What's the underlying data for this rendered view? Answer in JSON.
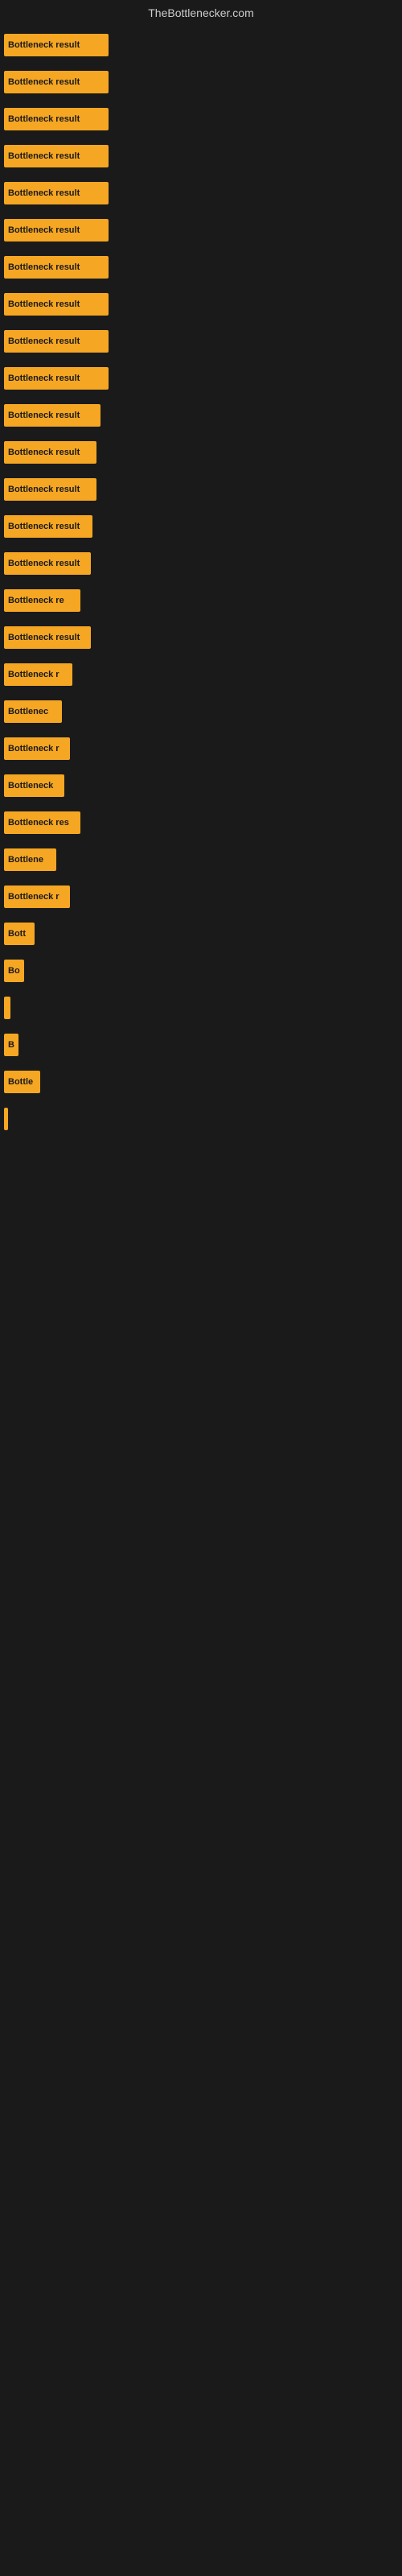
{
  "header": {
    "title": "TheBottlenecker.com"
  },
  "bars": [
    {
      "label": "Bottleneck result",
      "width": 130
    },
    {
      "label": "Bottleneck result",
      "width": 130
    },
    {
      "label": "Bottleneck result",
      "width": 130
    },
    {
      "label": "Bottleneck result",
      "width": 130
    },
    {
      "label": "Bottleneck result",
      "width": 130
    },
    {
      "label": "Bottleneck result",
      "width": 130
    },
    {
      "label": "Bottleneck result",
      "width": 130
    },
    {
      "label": "Bottleneck result",
      "width": 130
    },
    {
      "label": "Bottleneck result",
      "width": 130
    },
    {
      "label": "Bottleneck result",
      "width": 130
    },
    {
      "label": "Bottleneck result",
      "width": 120
    },
    {
      "label": "Bottleneck result",
      "width": 115
    },
    {
      "label": "Bottleneck result",
      "width": 115
    },
    {
      "label": "Bottleneck result",
      "width": 110
    },
    {
      "label": "Bottleneck result",
      "width": 108
    },
    {
      "label": "Bottleneck re",
      "width": 95
    },
    {
      "label": "Bottleneck result",
      "width": 108
    },
    {
      "label": "Bottleneck r",
      "width": 85
    },
    {
      "label": "Bottlenec",
      "width": 72
    },
    {
      "label": "Bottleneck r",
      "width": 82
    },
    {
      "label": "Bottleneck",
      "width": 75
    },
    {
      "label": "Bottleneck res",
      "width": 95
    },
    {
      "label": "Bottlene",
      "width": 65
    },
    {
      "label": "Bottleneck r",
      "width": 82
    },
    {
      "label": "Bott",
      "width": 38
    },
    {
      "label": "Bo",
      "width": 25
    },
    {
      "label": "",
      "width": 8
    },
    {
      "label": "B",
      "width": 18
    },
    {
      "label": "Bottle",
      "width": 45
    },
    {
      "label": "",
      "width": 5
    }
  ]
}
